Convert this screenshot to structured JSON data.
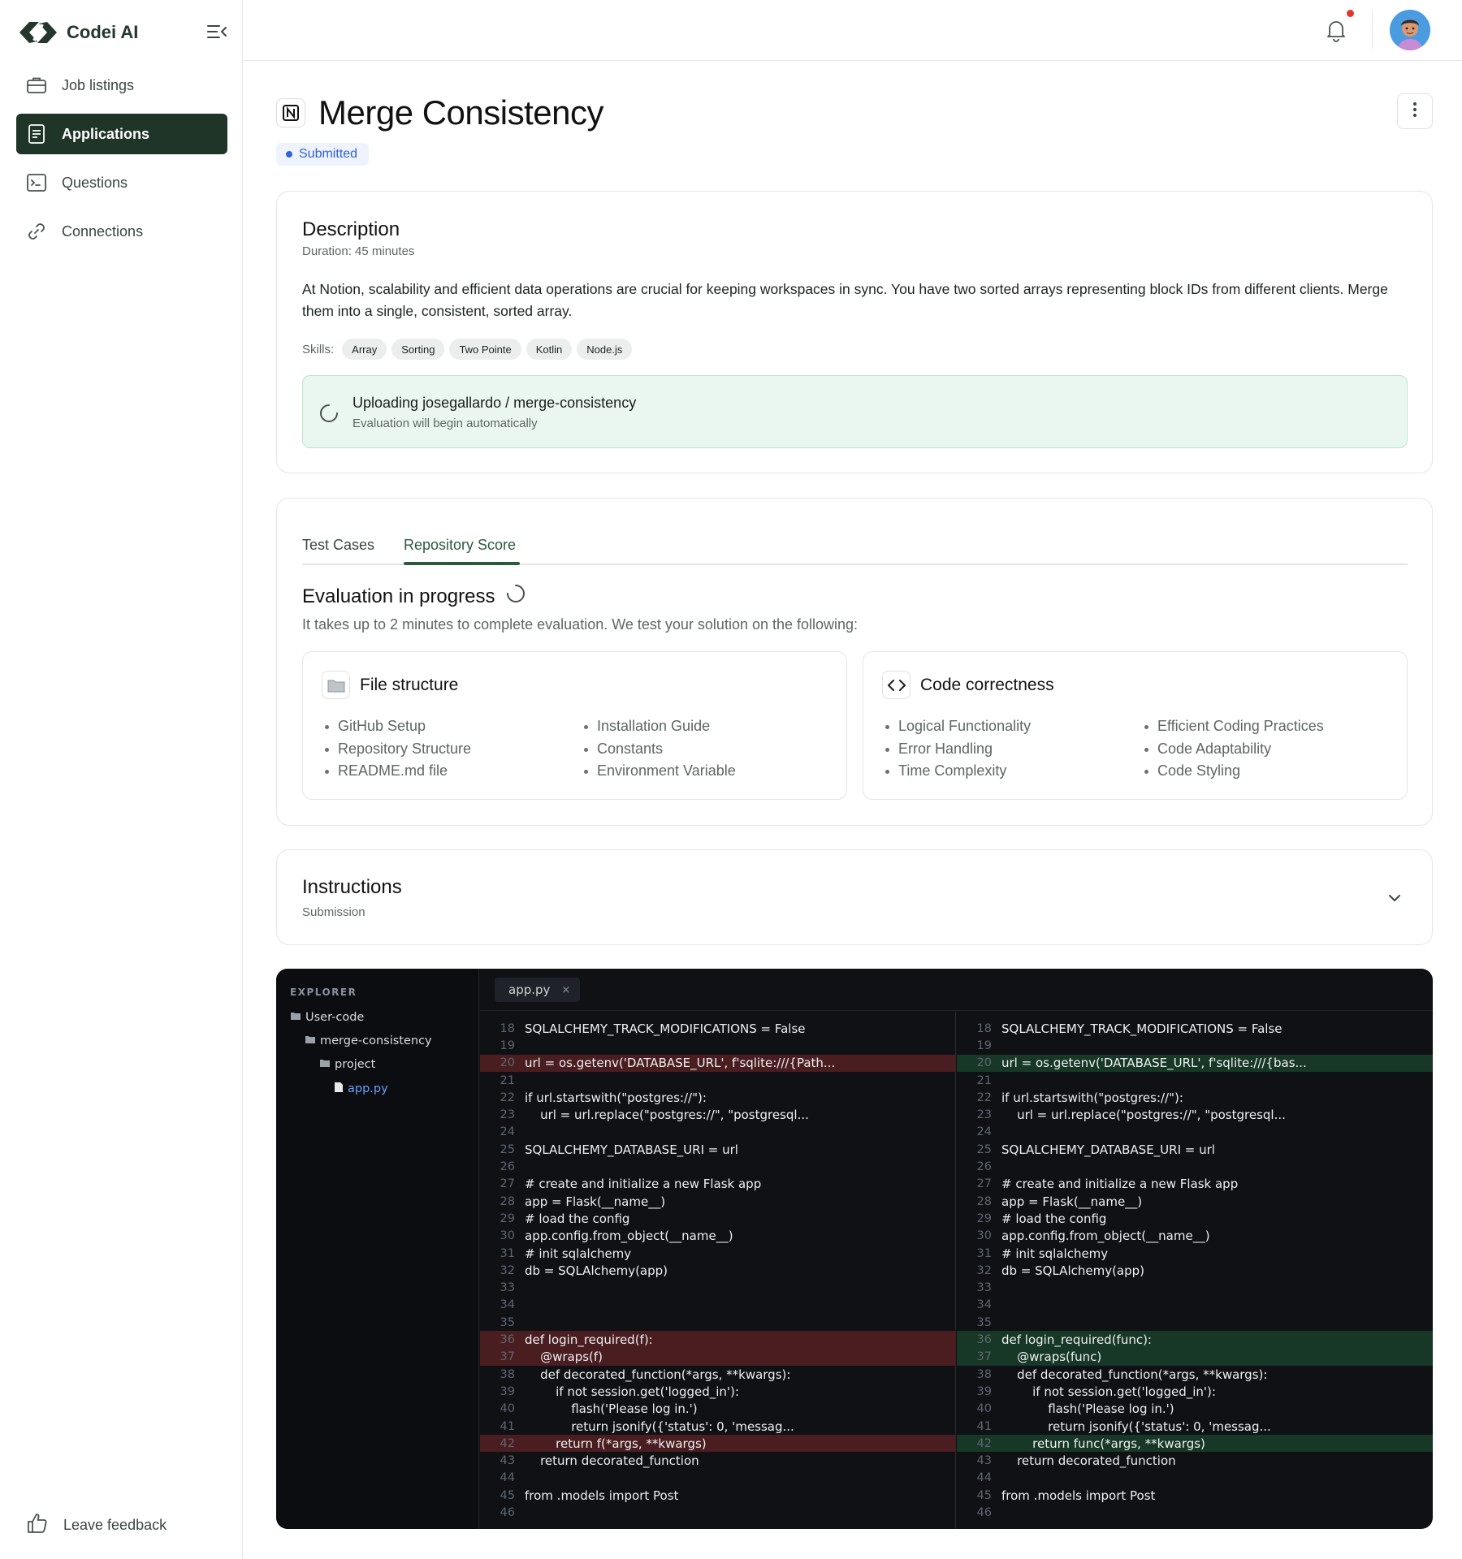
{
  "app": {
    "name": "Codei AI"
  },
  "sidebar": {
    "items": [
      {
        "label": "Job listings",
        "icon": "briefcase-icon",
        "active": false
      },
      {
        "label": "Applications",
        "icon": "document-icon",
        "active": true
      },
      {
        "label": "Questions",
        "icon": "terminal-icon",
        "active": false
      },
      {
        "label": "Connections",
        "icon": "link-icon",
        "active": false
      }
    ],
    "feedback_label": "Leave feedback"
  },
  "header": {
    "notification_icon": "bell-icon",
    "has_unread": true
  },
  "page": {
    "title": "Merge Consistency",
    "status": "Submitted"
  },
  "description": {
    "heading": "Description",
    "duration": "Duration: 45 minutes",
    "text": "At Notion, scalability and efficient data operations are crucial for keeping workspaces in sync. You have two sorted arrays representing block IDs from different clients. Merge them into a single, consistent, sorted array.",
    "skills_label": "Skills:",
    "skills": [
      "Array",
      "Sorting",
      "Two Pointe",
      "Kotlin",
      "Node.js"
    ],
    "upload": {
      "title": "Uploading josegallardo / merge-consistency",
      "subtitle": "Evaluation will begin automatically"
    }
  },
  "evaluation": {
    "tabs": [
      "Test Cases",
      "Repository Score"
    ],
    "active_tab": "Repository Score",
    "title": "Evaluation in progress",
    "subtitle": "It takes up to 2 minutes to complete evaluation. We test your solution on the following:",
    "cards": [
      {
        "title": "File structure",
        "icon": "folder-icon",
        "col1": [
          "GitHub Setup",
          "Repository Structure",
          "README.md file"
        ],
        "col2": [
          "Installation Guide",
          "Constants",
          "Environment Variable"
        ]
      },
      {
        "title": "Code correctness",
        "icon": "code-icon",
        "col1": [
          "Logical Functionality",
          "Error Handling",
          "Time Complexity"
        ],
        "col2": [
          "Efficient Coding Practices",
          "Code Adaptability",
          "Code Styling"
        ]
      }
    ]
  },
  "instructions": {
    "heading": "Instructions",
    "subtitle": "Submission"
  },
  "code_viewer": {
    "explorer_title": "EXPLORER",
    "tree": [
      {
        "name": "User-code",
        "type": "folder",
        "depth": 0
      },
      {
        "name": "merge-consistency",
        "type": "folder",
        "depth": 1
      },
      {
        "name": "project",
        "type": "folder",
        "depth": 2
      },
      {
        "name": "app.py",
        "type": "file",
        "depth": 3
      }
    ],
    "open_tab": "app.py",
    "left": [
      {
        "n": "18",
        "t": "SQLALCHEMY_TRACK_MODIFICATIONS = False",
        "s": ""
      },
      {
        "n": "19",
        "t": "",
        "s": ""
      },
      {
        "n": "20",
        "t": "url = os.getenv('DATABASE_URL', f'sqlite:///{Path...",
        "s": "del"
      },
      {
        "n": "21",
        "t": "",
        "s": ""
      },
      {
        "n": "22",
        "t": "if url.startswith(\"postgres://\"):",
        "s": ""
      },
      {
        "n": "23",
        "t": "    url = url.replace(\"postgres://\", \"postgresql...",
        "s": ""
      },
      {
        "n": "24",
        "t": "",
        "s": ""
      },
      {
        "n": "25",
        "t": "SQLALCHEMY_DATABASE_URI = url",
        "s": ""
      },
      {
        "n": "26",
        "t": "",
        "s": ""
      },
      {
        "n": "27",
        "t": "# create and initialize a new Flask app",
        "s": ""
      },
      {
        "n": "28",
        "t": "app = Flask(__name__)",
        "s": ""
      },
      {
        "n": "29",
        "t": "# load the config",
        "s": ""
      },
      {
        "n": "30",
        "t": "app.config.from_object(__name__)",
        "s": ""
      },
      {
        "n": "31",
        "t": "# init sqlalchemy",
        "s": ""
      },
      {
        "n": "32",
        "t": "db = SQLAlchemy(app)",
        "s": ""
      },
      {
        "n": "33",
        "t": "",
        "s": ""
      },
      {
        "n": "34",
        "t": "",
        "s": ""
      },
      {
        "n": "35",
        "t": "",
        "s": ""
      },
      {
        "n": "36",
        "t": "def login_required(f):",
        "s": "del"
      },
      {
        "n": "37",
        "t": "    @wraps(f)",
        "s": "del"
      },
      {
        "n": "38",
        "t": "    def decorated_function(*args, **kwargs):",
        "s": ""
      },
      {
        "n": "39",
        "t": "        if not session.get('logged_in'):",
        "s": ""
      },
      {
        "n": "40",
        "t": "            flash('Please log in.')",
        "s": ""
      },
      {
        "n": "41",
        "t": "            return jsonify({'status': 0, 'messag...",
        "s": ""
      },
      {
        "n": "42",
        "t": "        return f(*args, **kwargs)",
        "s": "del"
      },
      {
        "n": "43",
        "t": "    return decorated_function",
        "s": ""
      },
      {
        "n": "44",
        "t": "",
        "s": ""
      },
      {
        "n": "45",
        "t": "from .models import Post",
        "s": ""
      },
      {
        "n": "46",
        "t": "",
        "s": ""
      }
    ],
    "right": [
      {
        "n": "18",
        "t": "SQLALCHEMY_TRACK_MODIFICATIONS = False",
        "s": ""
      },
      {
        "n": "19",
        "t": "",
        "s": ""
      },
      {
        "n": "20",
        "t": "url = os.getenv('DATABASE_URL', f'sqlite:///{bas...",
        "s": "add"
      },
      {
        "n": "21",
        "t": "",
        "s": ""
      },
      {
        "n": "22",
        "t": "if url.startswith(\"postgres://\"):",
        "s": ""
      },
      {
        "n": "23",
        "t": "    url = url.replace(\"postgres://\", \"postgresql...",
        "s": ""
      },
      {
        "n": "24",
        "t": "",
        "s": ""
      },
      {
        "n": "25",
        "t": "SQLALCHEMY_DATABASE_URI = url",
        "s": ""
      },
      {
        "n": "26",
        "t": "",
        "s": ""
      },
      {
        "n": "27",
        "t": "# create and initialize a new Flask app",
        "s": ""
      },
      {
        "n": "28",
        "t": "app = Flask(__name__)",
        "s": ""
      },
      {
        "n": "29",
        "t": "# load the config",
        "s": ""
      },
      {
        "n": "30",
        "t": "app.config.from_object(__name__)",
        "s": ""
      },
      {
        "n": "31",
        "t": "# init sqlalchemy",
        "s": ""
      },
      {
        "n": "32",
        "t": "db = SQLAlchemy(app)",
        "s": ""
      },
      {
        "n": "33",
        "t": "",
        "s": ""
      },
      {
        "n": "34",
        "t": "",
        "s": ""
      },
      {
        "n": "35",
        "t": "",
        "s": ""
      },
      {
        "n": "36",
        "t": "def login_required(func):",
        "s": "add"
      },
      {
        "n": "37",
        "t": "    @wraps(func)",
        "s": "add"
      },
      {
        "n": "38",
        "t": "    def decorated_function(*args, **kwargs):",
        "s": ""
      },
      {
        "n": "39",
        "t": "        if not session.get('logged_in'):",
        "s": ""
      },
      {
        "n": "40",
        "t": "            flash('Please log in.')",
        "s": ""
      },
      {
        "n": "41",
        "t": "            return jsonify({'status': 0, 'messag...",
        "s": ""
      },
      {
        "n": "42",
        "t": "        return func(*args, **kwargs)",
        "s": "add"
      },
      {
        "n": "43",
        "t": "    return decorated_function",
        "s": ""
      },
      {
        "n": "44",
        "t": "",
        "s": ""
      },
      {
        "n": "45",
        "t": "from .models import Post",
        "s": ""
      },
      {
        "n": "46",
        "t": "",
        "s": ""
      }
    ]
  }
}
